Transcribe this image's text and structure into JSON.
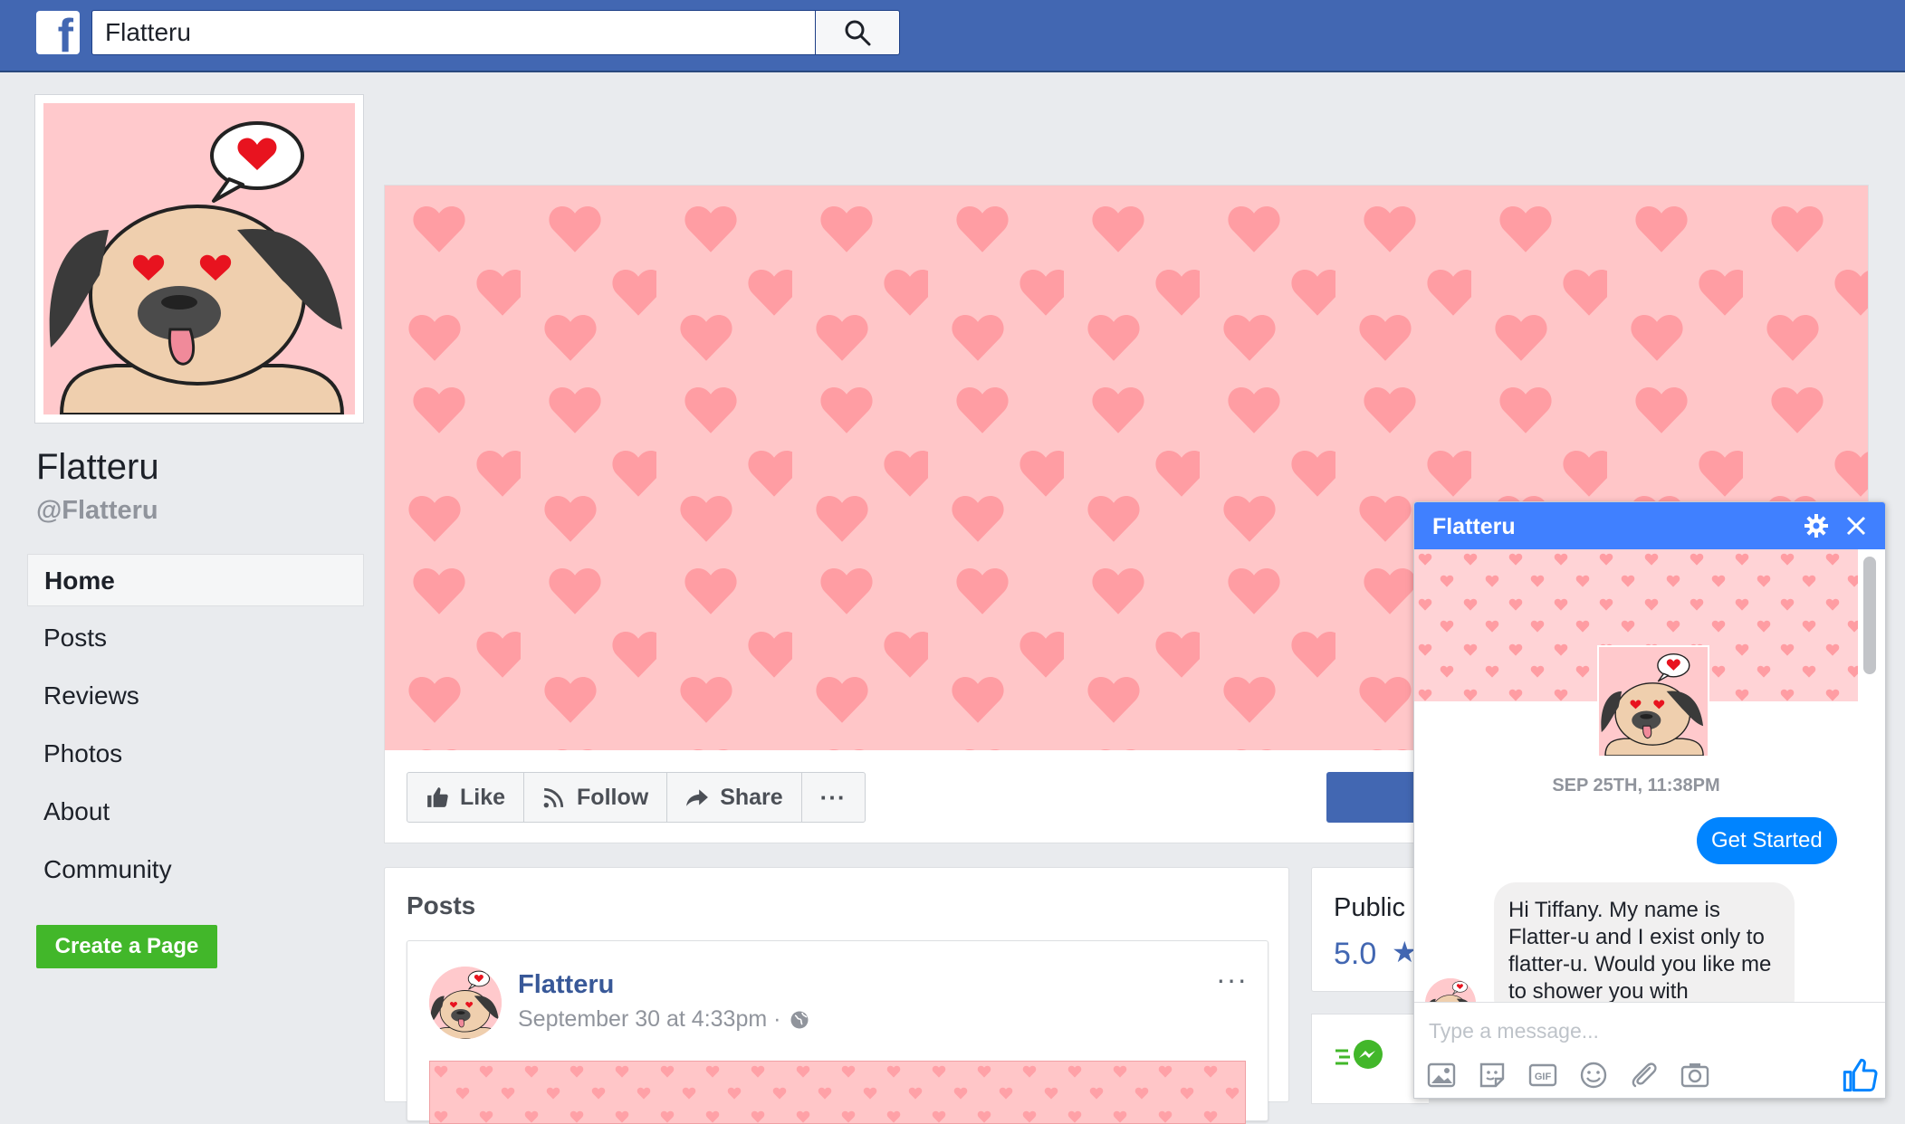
{
  "topbar": {
    "logo_icon": "facebook-f-icon",
    "search_value": "Flatteru",
    "search_icon": "search-icon"
  },
  "colors": {
    "facebook_blue": "#4267b2",
    "background": "#e9ebee",
    "cover_pink": "#ffc6c8",
    "heart_pink": "#ff9da3",
    "messenger_blue": "#0084ff",
    "create_green": "#42b72a"
  },
  "profile": {
    "name": "Flatteru",
    "handle": "@Flatteru"
  },
  "nav": {
    "items": [
      {
        "label": "Home",
        "active": true
      },
      {
        "label": "Posts"
      },
      {
        "label": "Reviews"
      },
      {
        "label": "Photos"
      },
      {
        "label": "About"
      },
      {
        "label": "Community"
      }
    ],
    "create_page": "Create a Page"
  },
  "actions": {
    "like": "Like",
    "follow": "Follow",
    "share": "Share",
    "more": "···"
  },
  "posts": {
    "heading": "Posts",
    "items": [
      {
        "author": "Flatteru",
        "date": "September 30 at 4:33pm ·",
        "privacy_icon": "globe-icon",
        "menu": "···"
      }
    ]
  },
  "public_card": {
    "title": "Public",
    "rating": "5.0",
    "star": "★"
  },
  "chat": {
    "title": "Flatteru",
    "timestamp": "SEP 25TH, 11:38PM",
    "get_started": "Get Started",
    "message": "Hi Tiffany. My name is Flatter-u and I exist only to flatter-u. Would you like me to shower you with",
    "input_placeholder": "Type a message...",
    "composer_icons": [
      "image-icon",
      "sticker-icon",
      "gif-icon",
      "emoji-icon",
      "paperclip-icon",
      "camera-icon"
    ],
    "like_icon": "thumbs-up-icon"
  }
}
